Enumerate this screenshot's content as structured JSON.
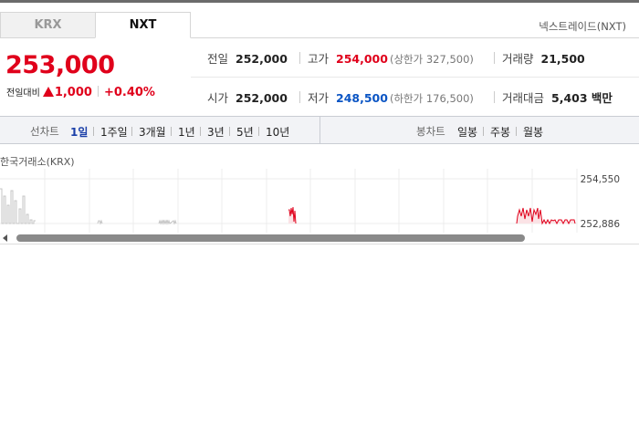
{
  "tabs": {
    "krx": "KRX",
    "nxt": "NXT"
  },
  "market_name": "넥스트레이드(NXT)",
  "price": {
    "current": "253,000",
    "change_label": "전일대비",
    "change_value": "1,000",
    "change_pct": "+0.40%"
  },
  "stats": {
    "prev_close_label": "전일",
    "prev_close": "252,000",
    "high_label": "고가",
    "high": "254,000",
    "upper_limit": "(상한가 327,500)",
    "volume_label": "거래량",
    "volume": "21,500",
    "open_label": "시가",
    "open": "252,000",
    "low_label": "저가",
    "low": "248,500",
    "lower_limit": "(하한가 176,500)",
    "amount_label": "거래대금",
    "amount": "5,403 백만"
  },
  "period_bar": {
    "line_chart_label": "선차트",
    "line_periods": [
      "1일",
      "1주일",
      "3개월",
      "1년",
      "3년",
      "5년",
      "10년"
    ],
    "candle_chart_label": "봉차트",
    "candle_periods": [
      "일봉",
      "주봉",
      "월봉"
    ]
  },
  "chart": {
    "source_label": "한국거래소(KRX)",
    "y_ticks": [
      "254,550",
      "252,886"
    ],
    "colors": {
      "krx": "#c4c4c4",
      "nxt": "#e0001b",
      "nxt_fill": "#fbe3e6"
    }
  },
  "colors": {
    "up": "#e0001b",
    "down": "#0b55c4",
    "active_period": "#1a3fa8"
  }
}
